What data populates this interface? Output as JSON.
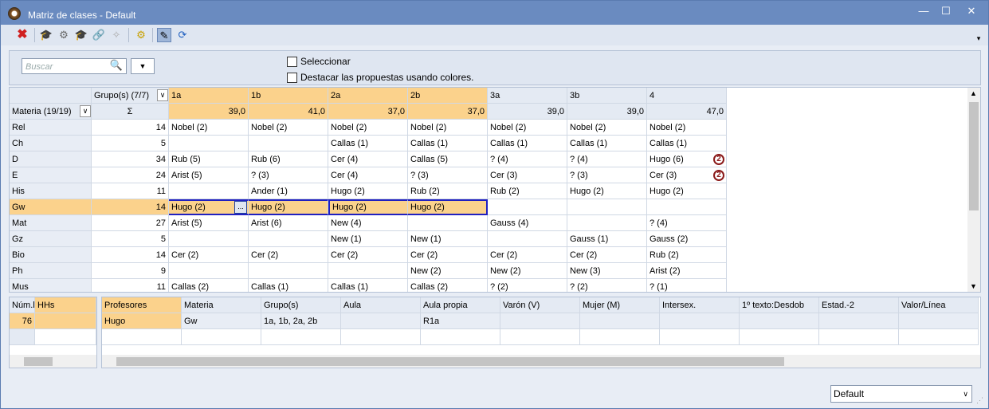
{
  "window": {
    "title": "Matriz de clases - Default",
    "minimize": "—",
    "maximize": "☐",
    "close": "✕"
  },
  "toolbar": {
    "icons": [
      "delete-icon",
      "mortarboard-icon",
      "settings-cog-icon",
      "teacher-icon",
      "link-icon",
      "magic-wand-icon",
      "gear-icon",
      "edit-pencil-icon",
      "refresh-icon"
    ]
  },
  "search": {
    "placeholder": "Buscar",
    "search_icon": "🔍",
    "dropdown_arrow": "▼"
  },
  "options": {
    "select_label": "Seleccionar",
    "highlight_label": "Destacar las propuestas usando colores."
  },
  "grid": {
    "group_header": "Grupo(s) (7/7)",
    "subject_header": "Materia (19/19)",
    "sigma": "Σ",
    "dropdown_arrow": "∨",
    "classes": [
      "1a",
      "1b",
      "2a",
      "2b",
      "3a",
      "3b",
      "4"
    ],
    "class_totals": [
      "39,0",
      "41,0",
      "37,0",
      "37,0",
      "39,0",
      "39,0",
      "47,0"
    ],
    "rows": [
      {
        "subject": "Rel",
        "sum": "14",
        "cells": [
          "Nobel (2)",
          "Nobel (2)",
          "Nobel (2)",
          "Nobel (2)",
          "Nobel (2)",
          "Nobel (2)",
          "Nobel (2)"
        ]
      },
      {
        "subject": "Ch",
        "sum": "5",
        "cells": [
          "",
          "",
          "Callas (1)",
          "Callas (1)",
          "Callas (1)",
          "Callas (1)",
          "Callas (1)"
        ]
      },
      {
        "subject": "D",
        "sum": "34",
        "cells": [
          "Rub (5)",
          "Rub (6)",
          "Cer (4)",
          "Callas (5)",
          "? (4)",
          "? (4)",
          "Hugo (6)"
        ]
      },
      {
        "subject": "E",
        "sum": "24",
        "cells": [
          "Arist (5)",
          "? (3)",
          "Cer (4)",
          "? (3)",
          "Cer (3)",
          "? (3)",
          "Cer (3)"
        ]
      },
      {
        "subject": "His",
        "sum": "11",
        "cells": [
          "",
          "Ander (1)",
          "Hugo (2)",
          "Rub (2)",
          "Rub (2)",
          "Hugo (2)",
          "Hugo (2)"
        ]
      },
      {
        "subject": "Gw",
        "sum": "14",
        "cells": [
          "Hugo (2)",
          "Hugo (2)",
          "Hugo (2)",
          "Hugo (2)",
          "",
          "",
          ""
        ]
      },
      {
        "subject": "Mat",
        "sum": "27",
        "cells": [
          "Arist (5)",
          "Arist (6)",
          "New (4)",
          "",
          "Gauss (4)",
          "",
          "? (4)"
        ]
      },
      {
        "subject": "Gz",
        "sum": "5",
        "cells": [
          "",
          "",
          "New (1)",
          "New (1)",
          "",
          "Gauss (1)",
          "Gauss (2)"
        ]
      },
      {
        "subject": "Bio",
        "sum": "14",
        "cells": [
          "Cer (2)",
          "Cer (2)",
          "Cer (2)",
          "Cer (2)",
          "Cer (2)",
          "Cer (2)",
          "Rub (2)"
        ]
      },
      {
        "subject": "Ph",
        "sum": "9",
        "cells": [
          "",
          "",
          "",
          "New (2)",
          "New (2)",
          "New (3)",
          "Arist (2)"
        ]
      },
      {
        "subject": "Mus",
        "sum": "11",
        "cells": [
          "Callas (2)",
          "Callas (1)",
          "Callas (1)",
          "Callas (2)",
          "? (2)",
          "? (2)",
          "? (1)"
        ]
      }
    ],
    "badges": [
      "2",
      "2"
    ],
    "ellipsis": "..."
  },
  "bottom_left": {
    "headers": [
      "Núm.l",
      "HHs"
    ],
    "value": "76"
  },
  "bottom_right": {
    "headers": [
      "Profesores",
      "Materia",
      "Grupo(s)",
      "Aula",
      "Aula propia",
      "Varón (V)",
      "Mujer (M)",
      "Intersex.",
      "1º texto:Desdob",
      "Estad.-2",
      "Valor/Línea"
    ],
    "row": [
      "Hugo",
      "Gw",
      "1a, 1b, 2a, 2b",
      "",
      "R1a",
      "",
      "",
      "",
      "",
      "",
      ""
    ]
  },
  "view_select": {
    "value": "Default",
    "arrow": "∨"
  },
  "colors": {
    "accent": "#fbd28c",
    "title_bar": "#6a8bc0",
    "selection_border": "#2020c0"
  }
}
